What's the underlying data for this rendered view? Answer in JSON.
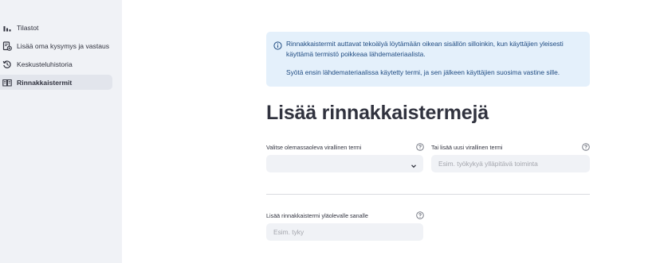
{
  "sidebar": {
    "items": [
      {
        "label": "Tilastot",
        "icon": "bar-chart-icon",
        "active": false
      },
      {
        "label": "Lisää oma kysymys ja vastaus",
        "icon": "add-document-icon",
        "active": false
      },
      {
        "label": "Keskusteluhistoria",
        "icon": "history-icon",
        "active": false
      },
      {
        "label": "Rinnakkaistermit",
        "icon": "book-icon",
        "active": true
      }
    ]
  },
  "info": {
    "line1": "Rinnakkaistermit auttavat tekoälyä löytämään oikean sisällön silloinkin, kun käyttäjien yleisesti",
    "line2": "käyttämä termistö poikkeaa lähdemateriaalista.",
    "line3": "Syötä ensin lähdemateriaalissa käytetty termi, ja sen jälkeen käyttäjien suosima vastine sille."
  },
  "heading": "Lisää rinnakkaistermejä",
  "form": {
    "select_label": "Valitse olemassaoleva virallinen termi",
    "select_value": "",
    "new_term_label": "Tai lisää uusi virallinen termi",
    "new_term_placeholder": "Esim. työkykyä ylläpitävä toiminta",
    "synonym_label": "Lisää rinnakkaistermi yläolevalle sanalle",
    "synonym_placeholder": "Esim. tyky"
  },
  "colors": {
    "sidebar_bg": "#f0f2f6",
    "info_bg": "#e4f0fb",
    "info_text": "#214d83",
    "input_bg": "#f0f2f6"
  }
}
